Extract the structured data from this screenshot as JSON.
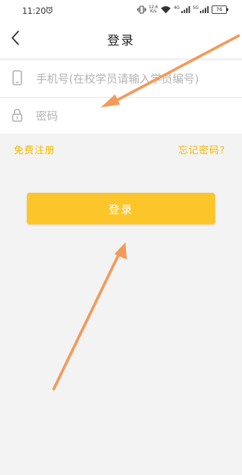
{
  "status_bar": {
    "time": "11:20",
    "net_speed_value": "12.6",
    "net_speed_unit": "K/s",
    "network_badge_1": "4G",
    "network_badge_2": "5G",
    "battery": "76",
    "icons": [
      "alarm-icon",
      "vibrate-icon",
      "wifi-icon",
      "signal-icon",
      "battery-icon"
    ]
  },
  "header": {
    "title": "登录",
    "back_icon": "chevron-left-icon"
  },
  "form": {
    "phone_placeholder": "手机号(在校学员请输入学员编号)",
    "password_placeholder": "密码",
    "phone_icon": "phone-icon",
    "password_icon": "lock-icon"
  },
  "links": {
    "register": "免费注册",
    "forgot": "忘记密码?"
  },
  "login_button": "登录",
  "colors": {
    "accent": "#fcc62a",
    "link": "#f5b800",
    "annotation_arrow": "#f39a5a",
    "background": "#f3f3f3"
  }
}
